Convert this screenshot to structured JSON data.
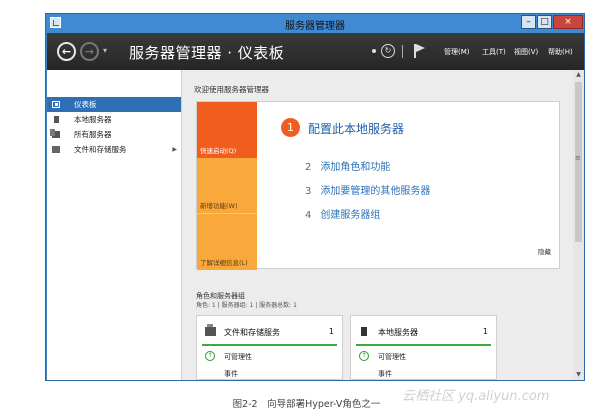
{
  "window": {
    "title": "服务器管理器",
    "controls": {
      "minimize": "–",
      "maximize": "□",
      "close": "×"
    }
  },
  "toolbar": {
    "back_icon": "arrow-left-icon",
    "forward_icon": "arrow-right-icon",
    "breadcrumb": "服务器管理器 · 仪表板",
    "refresh_icon": "refresh-icon",
    "notifications_icon": "flag-icon",
    "menus": [
      "管理(M)",
      "工具(T)",
      "视图(V)",
      "帮助(H)"
    ]
  },
  "sidebar": {
    "items": [
      {
        "label": "仪表板",
        "icon": "dashboard-icon",
        "active": true
      },
      {
        "label": "本地服务器",
        "icon": "server-icon",
        "active": false
      },
      {
        "label": "所有服务器",
        "icon": "servers-icon",
        "active": false
      },
      {
        "label": "文件和存储服务",
        "icon": "storage-icon",
        "active": false,
        "has_submenu": true
      }
    ]
  },
  "welcome": {
    "title": "欢迎使用服务器管理器",
    "tabs": [
      "快速启动(Q)",
      "新增功能(W)",
      "了解详细信息(L)"
    ],
    "step1": {
      "number": "1",
      "text": "配置此本地服务器"
    },
    "steps": [
      {
        "number": "2",
        "text": "添加角色和功能"
      },
      {
        "number": "3",
        "text": "添加要管理的其他服务器"
      },
      {
        "number": "4",
        "text": "创建服务器组"
      }
    ],
    "hide": "隐藏"
  },
  "roles": {
    "title": "角色和服务器组",
    "subtitle": "角色: 1 | 服务器组: 1 | 服务器总数: 1",
    "cards": [
      {
        "title": "文件和存储服务",
        "count": "1",
        "status": "可管理性",
        "row2": "事件"
      },
      {
        "title": "本地服务器",
        "count": "1",
        "status": "可管理性",
        "row2": "事件"
      }
    ]
  },
  "caption": "图2-2　向导部署Hyper-V角色之一",
  "watermark": "云栖社区 yq.aliyun.com",
  "colors": {
    "accent_orange": "#f05d1e",
    "tab_orange": "#f9a83b",
    "link_blue": "#2b70b8",
    "status_green": "#3daa3d",
    "sidebar_active": "#2f6fb6"
  }
}
